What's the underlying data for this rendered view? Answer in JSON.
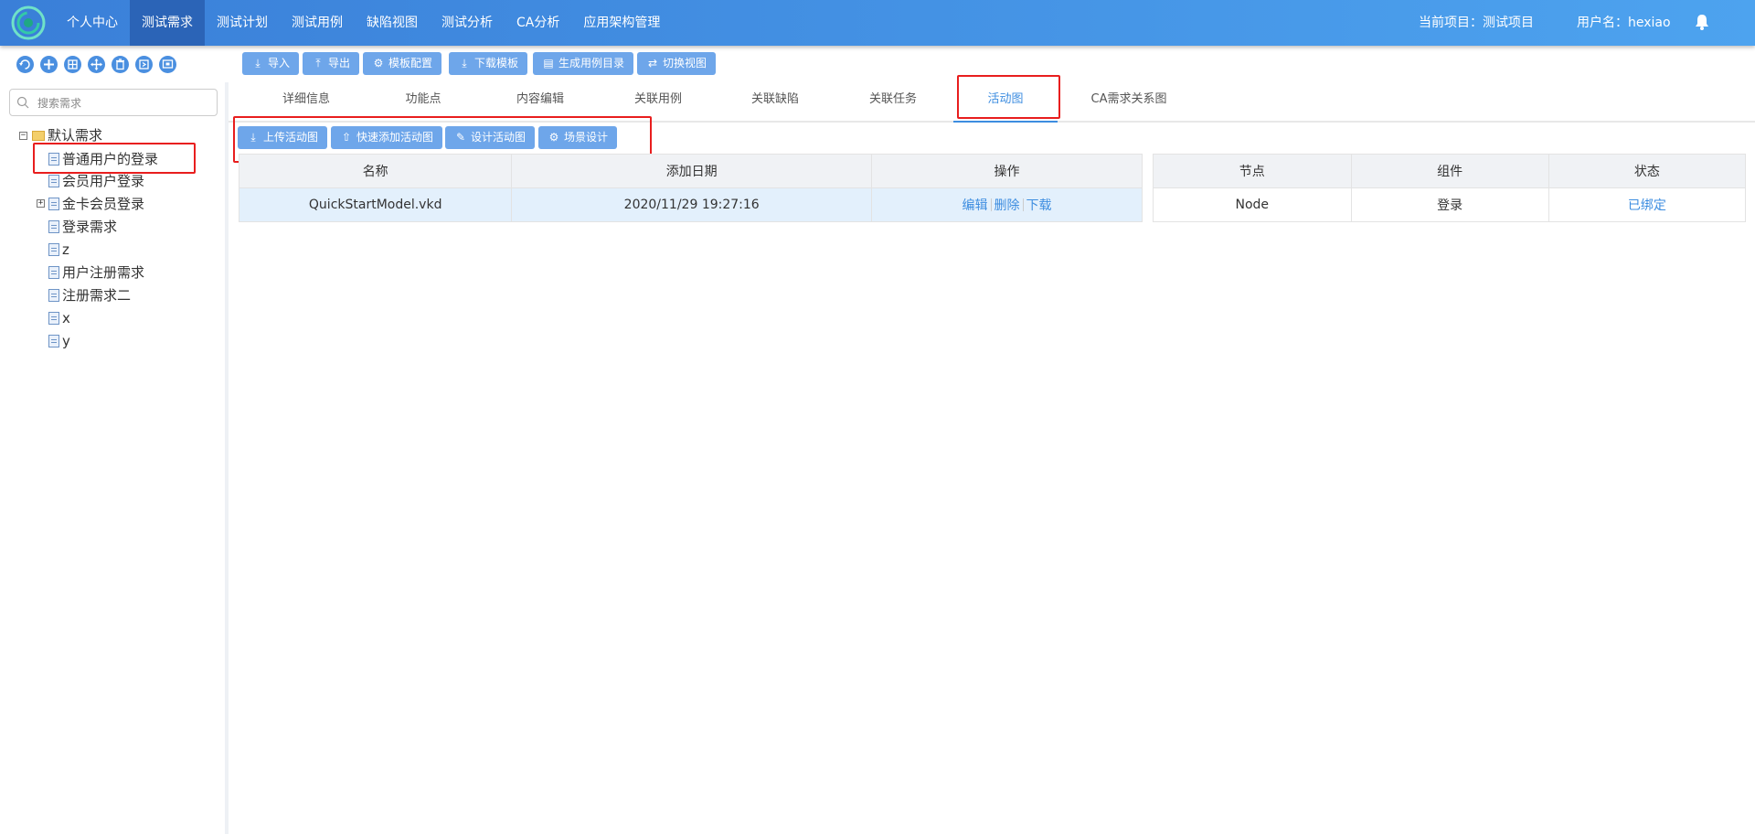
{
  "nav": {
    "items": [
      {
        "label": "个人中心",
        "active": false
      },
      {
        "label": "测试需求",
        "active": true
      },
      {
        "label": "测试计划",
        "active": false
      },
      {
        "label": "测试用例",
        "active": false
      },
      {
        "label": "缺陷视图",
        "active": false
      },
      {
        "label": "测试分析",
        "active": false
      },
      {
        "label": "CA分析",
        "active": false
      },
      {
        "label": "应用架构管理",
        "active": false
      }
    ],
    "current_project": "当前项目：测试项目",
    "username": "用户名：hexiao"
  },
  "toolbar": {
    "icons": [
      "refresh-icon",
      "add-icon",
      "grid-icon",
      "move-icon",
      "delete-icon",
      "export-icon",
      "screen-icon"
    ],
    "buttons": [
      "导入",
      "导出",
      "模板配置",
      "下载模板",
      "生成用例目录",
      "切换视图"
    ]
  },
  "sidebar": {
    "search_placeholder": "搜索需求",
    "root": "默认需求",
    "items": [
      "普通用户的登录",
      "会员用户登录",
      "金卡会员登录",
      "登录需求",
      "z",
      "用户注册需求",
      "注册需求二",
      "x",
      "y"
    ]
  },
  "tabs": [
    "详细信息",
    "功能点",
    "内容编辑",
    "关联用例",
    "关联缺陷",
    "关联任务",
    "活动图",
    "CA需求关系图"
  ],
  "active_tab": "活动图",
  "actions": [
    "上传活动图",
    "快速添加活动图",
    "设计活动图",
    "场景设计"
  ],
  "files_table": {
    "headers": [
      "名称",
      "添加日期",
      "操作"
    ],
    "rows": [
      {
        "name": "QuickStartModel.vkd",
        "date": "2020/11/29 19:27:16",
        "ops": [
          "编辑",
          "删除",
          "下载"
        ]
      }
    ]
  },
  "nodes_table": {
    "headers": [
      "节点",
      "组件",
      "状态"
    ],
    "rows": [
      {
        "node": "Node",
        "component": "登录",
        "status": "已绑定"
      }
    ]
  },
  "colors": {
    "nav_start": "#3a7fd8",
    "nav_end": "#4da3ef",
    "accent": "#3d8de0",
    "button": "#6ea6ea",
    "highlight": "#e81e1e"
  }
}
